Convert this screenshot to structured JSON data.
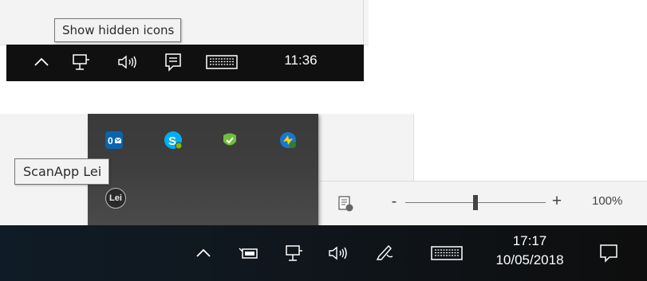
{
  "top_panel": {
    "tooltip": "Show hidden icons",
    "clock": "11:36",
    "icons": [
      "chevron-up-icon",
      "network-icon",
      "volume-icon",
      "action-center-icon",
      "keyboard-icon"
    ]
  },
  "bottom_panel": {
    "tooltip": "ScanApp Lei",
    "overflow_icons": [
      {
        "name": "outlook-icon",
        "label": "0"
      },
      {
        "name": "skype-icon",
        "label": "S"
      },
      {
        "name": "green-app-icon"
      },
      {
        "name": "sync-icon"
      }
    ],
    "scanapp_icon_label": "Lei",
    "zoom": {
      "minus": "-",
      "plus": "+",
      "percent": "100%",
      "level": 0.5
    },
    "clock": {
      "time": "17:17",
      "date": "10/05/2018"
    },
    "icons": [
      "chevron-up-icon",
      "battery-icon",
      "network-icon",
      "volume-icon",
      "pen-icon",
      "keyboard-icon",
      "notification-icon"
    ]
  },
  "colors": {
    "taskbar": "#101010",
    "tooltip_bg": "#f2f2f2",
    "outlook": "#0a64ad",
    "skype": "#00aff0",
    "green_app": "#6fbe3b",
    "sync": "#1976d2"
  }
}
